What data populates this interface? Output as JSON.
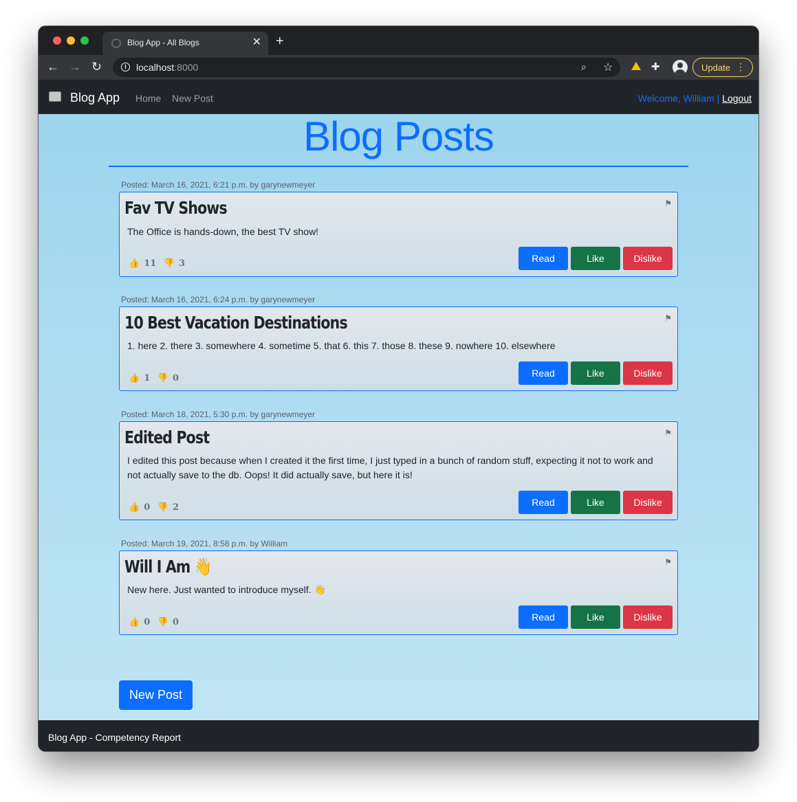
{
  "browser": {
    "tab_title": "Blog App - All Blogs",
    "tab_close": "✕",
    "new_tab": "+",
    "address_host": "localhost",
    "address_port": ":8000",
    "update_label": "Update",
    "icons": [
      "back-arrow-icon",
      "forward-arrow-icon",
      "reload-icon",
      "info-icon",
      "zoom-icon",
      "star-icon",
      "drive-icon",
      "puzzle-icon",
      "profile-icon",
      "menu-dots-icon"
    ]
  },
  "navbar": {
    "brand": "Blog App",
    "home": "Home",
    "new_post": "New Post",
    "welcome": "Welcome, William |",
    "logout": "Logout"
  },
  "page": {
    "title": "Blog Posts"
  },
  "posts": [
    {
      "meta": "Posted: March 16, 2021, 6:21 p.m. by garynewmeyer",
      "title": "Fav TV Shows",
      "body": "The Office is hands-down, the best TV show!",
      "likes": "11",
      "dislikes": "3"
    },
    {
      "meta": "Posted: March 16, 2021, 6:24 p.m. by garynewmeyer",
      "title": "10 Best Vacation Destinations",
      "body": "1. here 2. there 3. somewhere 4. sometime 5. that 6. this 7. those 8. these 9. nowhere 10. elsewhere",
      "likes": "1",
      "dislikes": "0"
    },
    {
      "meta": "Posted: March 18, 2021, 5:30 p.m. by garynewmeyer",
      "title": "Edited Post",
      "body": "I edited this post because when I created it the first time, I just typed in a bunch of random stuff, expecting it not to work and not actually save to the db. Oops! It did actually save, but here it is!",
      "likes": "0",
      "dislikes": "2"
    },
    {
      "meta": "Posted: March 19, 2021, 8:58 p.m. by William",
      "title": "Will I Am 👋",
      "body": "New here. Just wanted to introduce myself. 👋",
      "likes": "0",
      "dislikes": "0"
    }
  ],
  "buttons": {
    "read": "Read",
    "like": "Like",
    "dislike": "Dislike"
  },
  "bottom": {
    "new_post": "New Post"
  },
  "footer": {
    "text": "Blog App - Competency Report"
  },
  "colors": {
    "primary": "#0d6efd",
    "success": "#157347",
    "danger": "#dc3545",
    "navbar": "#212529",
    "background_top": "#9dd5ee",
    "background_bottom": "#c1e5f4"
  }
}
